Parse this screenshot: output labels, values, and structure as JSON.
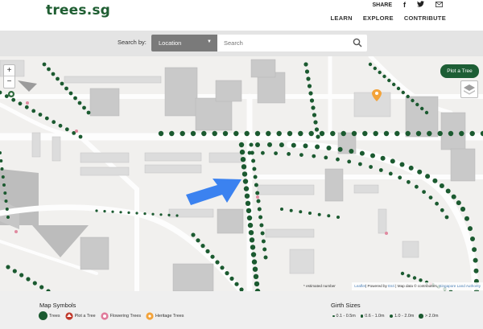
{
  "header": {
    "logo": "trees.sg",
    "share_label": "SHARE",
    "share_icons": [
      "facebook-icon",
      "twitter-icon",
      "mail-icon"
    ],
    "nav": [
      "LEARN",
      "EXPLORE",
      "CONTRIBUTE"
    ]
  },
  "search": {
    "label": "Search by:",
    "select_value": "Location",
    "placeholder": "Search"
  },
  "map": {
    "zoom_in": "+",
    "zoom_out": "−",
    "plot_button": "Plot a Tree",
    "estimated_note": "* estimated number",
    "attribution": {
      "leaflet": "Leaflet",
      "powered": "| Powered by ",
      "esri": "Esri",
      "mapdata": " | Map data © contributors, ",
      "sla": "Singapore Land Authority"
    },
    "tree_color": "#1b5a30",
    "arrow_color": "#3b82f0"
  },
  "legend": {
    "symbols_title": "Map Symbols",
    "symbols": [
      "Trees",
      "Plot a Tree",
      "Flowering Trees",
      "Heritage Trees"
    ],
    "girth_title": "Girth Sizes",
    "girth": [
      "0.1 - 0.5m",
      "0.6 - 1.0m",
      "1.0 - 2.0m",
      "> 2.0m"
    ]
  }
}
